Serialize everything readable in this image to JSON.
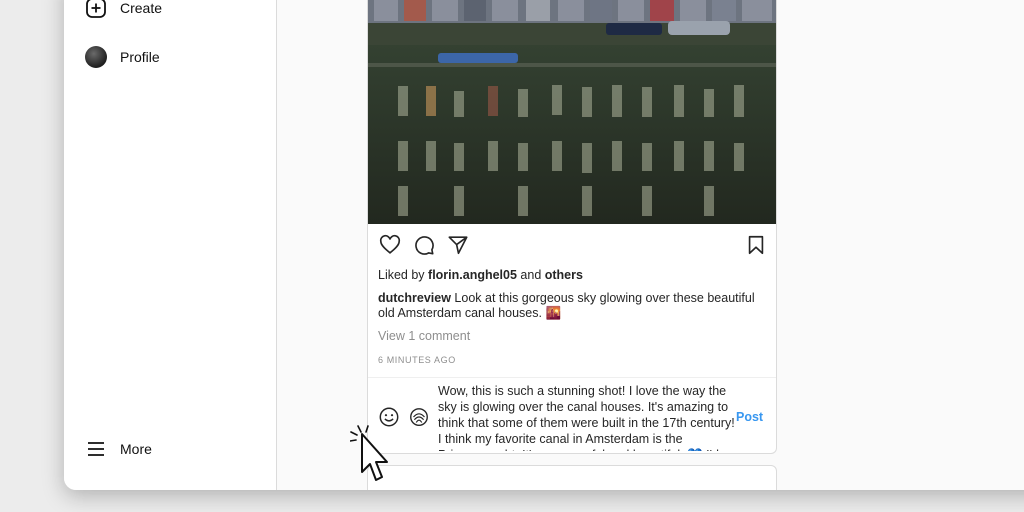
{
  "sidebar": {
    "items": [
      {
        "label": "Create",
        "icon": "plus-square-icon"
      },
      {
        "label": "Profile",
        "icon": "avatar"
      },
      {
        "label": "More",
        "icon": "hamburger-menu-icon"
      }
    ]
  },
  "post": {
    "liked_by_prefix": "Liked by ",
    "liked_by_user": "florin.anghel05",
    "liked_by_and": " and ",
    "liked_by_others": "others",
    "caption_user": "dutchreview",
    "caption_text": " Look at this gorgeous sky glowing over these beautiful old Amsterdam canal houses. 🌇",
    "view_comments": "View 1 comment",
    "timestamp": "6 MINUTES AGO",
    "comment_draft": "Wow, this is such a stunning shot! I love the way the sky is glowing over the canal houses. It's amazing to think that some of them were built in the 17th century! I think my favorite canal in Amsterdam is the Prinsengracht. It's so peaceful and beautiful. 💙 I'd",
    "post_button": "Post"
  },
  "colors": {
    "accent": "#3897f0",
    "text": "#262626",
    "muted": "#8e8e8e",
    "border": "#dbdbdb"
  }
}
